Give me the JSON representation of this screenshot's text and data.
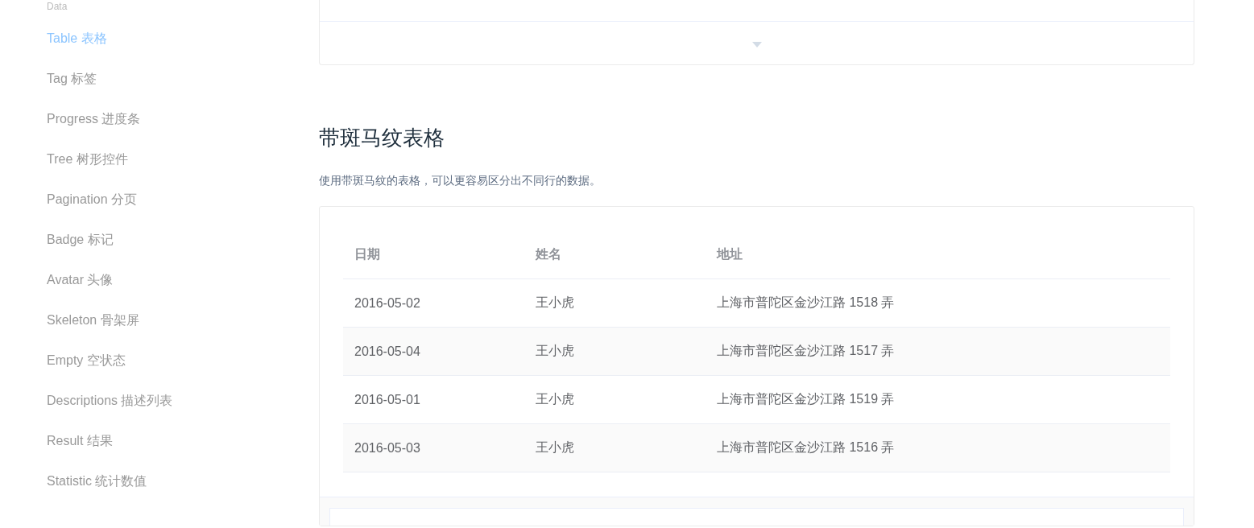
{
  "sidebar": {
    "group_label": "Data",
    "items": [
      {
        "label": "Table 表格",
        "selected": true
      },
      {
        "label": "Tag 标签",
        "selected": false
      },
      {
        "label": "Progress 进度条",
        "selected": false
      },
      {
        "label": "Tree 树形控件",
        "selected": false
      },
      {
        "label": "Pagination 分页",
        "selected": false
      },
      {
        "label": "Badge 标记",
        "selected": false
      },
      {
        "label": "Avatar 头像",
        "selected": false
      },
      {
        "label": "Skeleton 骨架屏",
        "selected": false
      },
      {
        "label": "Empty 空状态",
        "selected": false
      },
      {
        "label": "Descriptions 描述列表",
        "selected": false
      },
      {
        "label": "Result 结果",
        "selected": false
      },
      {
        "label": "Statistic 统计数值",
        "selected": false
      }
    ]
  },
  "section": {
    "title": "带斑马纹表格",
    "description": "使用带斑马纹的表格，可以更容易区分出不同行的数据。",
    "table": {
      "columns": [
        "日期",
        "姓名",
        "地址"
      ],
      "rows": [
        [
          "2016-05-02",
          "王小虎",
          "上海市普陀区金沙江路 1518 弄"
        ],
        [
          "2016-05-04",
          "王小虎",
          "上海市普陀区金沙江路 1517 弄"
        ],
        [
          "2016-05-01",
          "王小虎",
          "上海市普陀区金沙江路 1519 弄"
        ],
        [
          "2016-05-03",
          "王小虎",
          "上海市普陀区金沙江路 1516 弄"
        ]
      ],
      "stripe": true
    }
  }
}
